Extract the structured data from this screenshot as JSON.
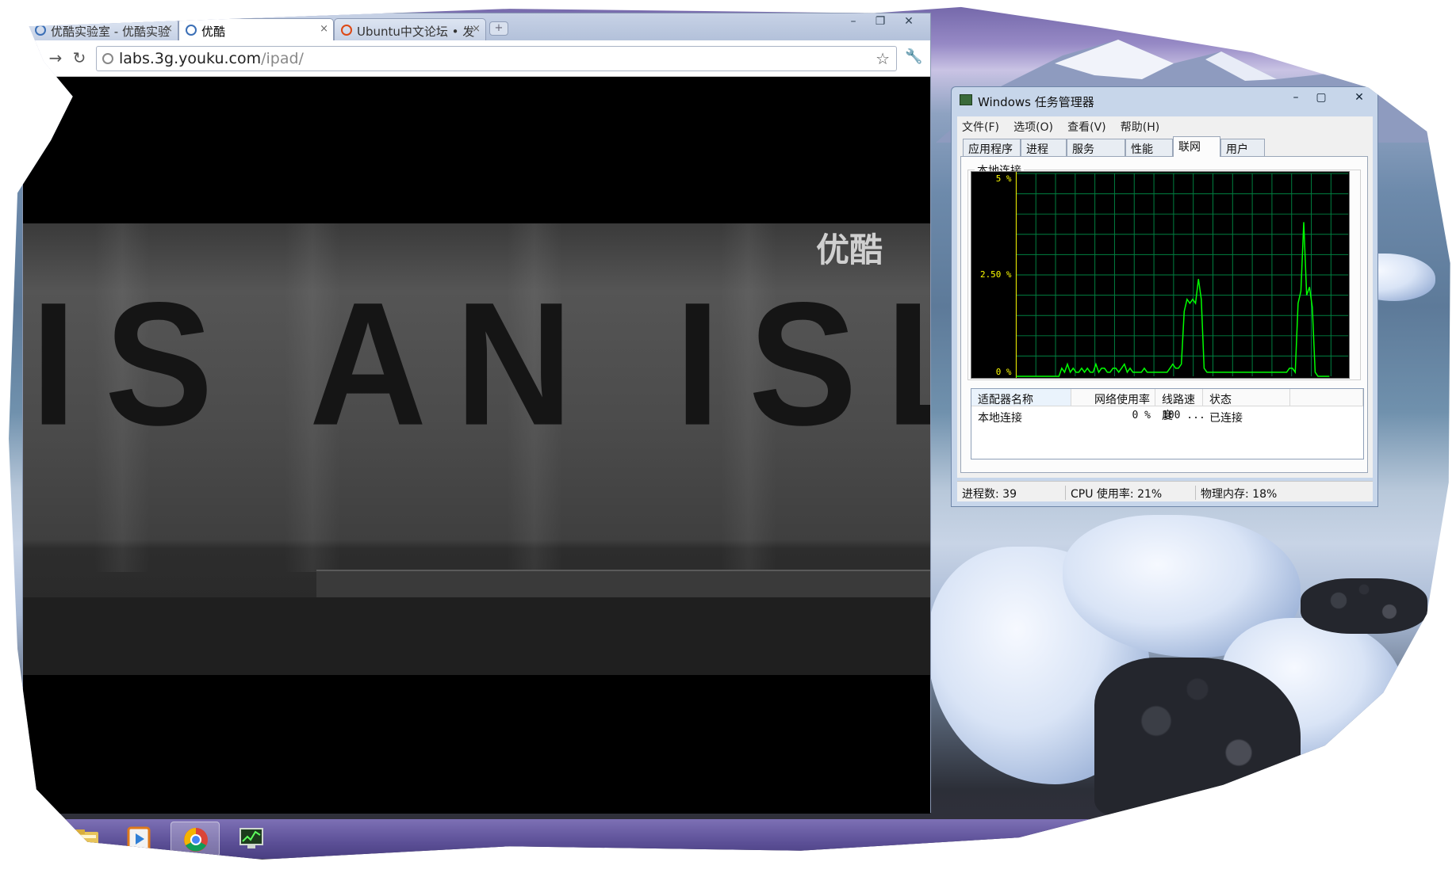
{
  "browser": {
    "tabs": [
      {
        "title": "优酷实验室 - 优酷实验",
        "active": false,
        "icon": "youku-icon"
      },
      {
        "title": "优酷",
        "active": true,
        "icon": "globe-icon"
      },
      {
        "title": "Ubuntu中文论坛 • 发",
        "active": false,
        "icon": "ubuntu-icon"
      }
    ],
    "address": {
      "host": "labs.3g.youku.com",
      "path": "/ipad/"
    },
    "video": {
      "caption": "IS AN ISLA",
      "logo": "优酷"
    }
  },
  "taskmgr": {
    "title": "Windows 任务管理器",
    "menu": [
      "文件(F)",
      "选项(O)",
      "查看(V)",
      "帮助(H)"
    ],
    "tabs": [
      "应用程序",
      "进程",
      "服务",
      "性能",
      "联网",
      "用户"
    ],
    "active_tab": "联网",
    "group_label": "本地连接",
    "graph": {
      "y_labels": [
        "5 %",
        "2.50 %",
        "0 %"
      ],
      "line_color": "#00ff00",
      "grid_color": "#008040",
      "ymax": 5,
      "values": [
        0,
        0,
        0,
        0,
        0,
        0,
        0,
        0,
        0,
        0,
        0,
        0,
        0,
        0,
        0,
        0,
        0.2,
        0.1,
        0.3,
        0.1,
        0.2,
        0.1,
        0.1,
        0.2,
        0.1,
        0.2,
        0.1,
        0.1,
        0.3,
        0.1,
        0.2,
        0.2,
        0.1,
        0.1,
        0.2,
        0.2,
        0.1,
        0.2,
        0.3,
        0.1,
        0.2,
        0.1,
        0.1,
        0.1,
        0.1,
        0.2,
        0.1,
        0.1,
        0.1,
        0.1,
        0.1,
        0.1,
        0.1,
        0.1,
        0.2,
        0.3,
        0.2,
        0.2,
        0.3,
        1.6,
        1.9,
        1.8,
        1.9,
        1.8,
        2.4,
        1.9,
        0.2,
        0.1,
        0.1,
        0.1,
        0.1,
        0.1,
        0.1,
        0.1,
        0.1,
        0.1,
        0.1,
        0.1,
        0.1,
        0.1,
        0.1,
        0.1,
        0.1,
        0.1,
        0.1,
        0.1,
        0.1,
        0.1,
        0.1,
        0.1,
        0.1,
        0.1,
        0.1,
        0.1,
        0.1,
        0.1,
        0.2,
        0.2,
        0.1,
        1.8,
        2.1,
        3.8,
        2.0,
        2.2,
        1.7,
        0.1,
        0,
        0,
        0,
        0,
        0
      ]
    },
    "table": {
      "headers": [
        "适配器名称",
        "网络使用率",
        "线路速度",
        "状态"
      ],
      "row": [
        "本地连接",
        "0 %",
        "100 ...",
        "已连接"
      ]
    },
    "status": [
      "进程数: 39",
      "CPU 使用率: 21%",
      "物理内存: 18%"
    ]
  },
  "taskbar": {
    "items": [
      {
        "icon": "folder-icon",
        "active": false
      },
      {
        "icon": "media-player-icon",
        "active": false
      },
      {
        "icon": "chrome-icon",
        "active": true
      },
      {
        "icon": "task-manager-icon",
        "active": false
      }
    ]
  }
}
